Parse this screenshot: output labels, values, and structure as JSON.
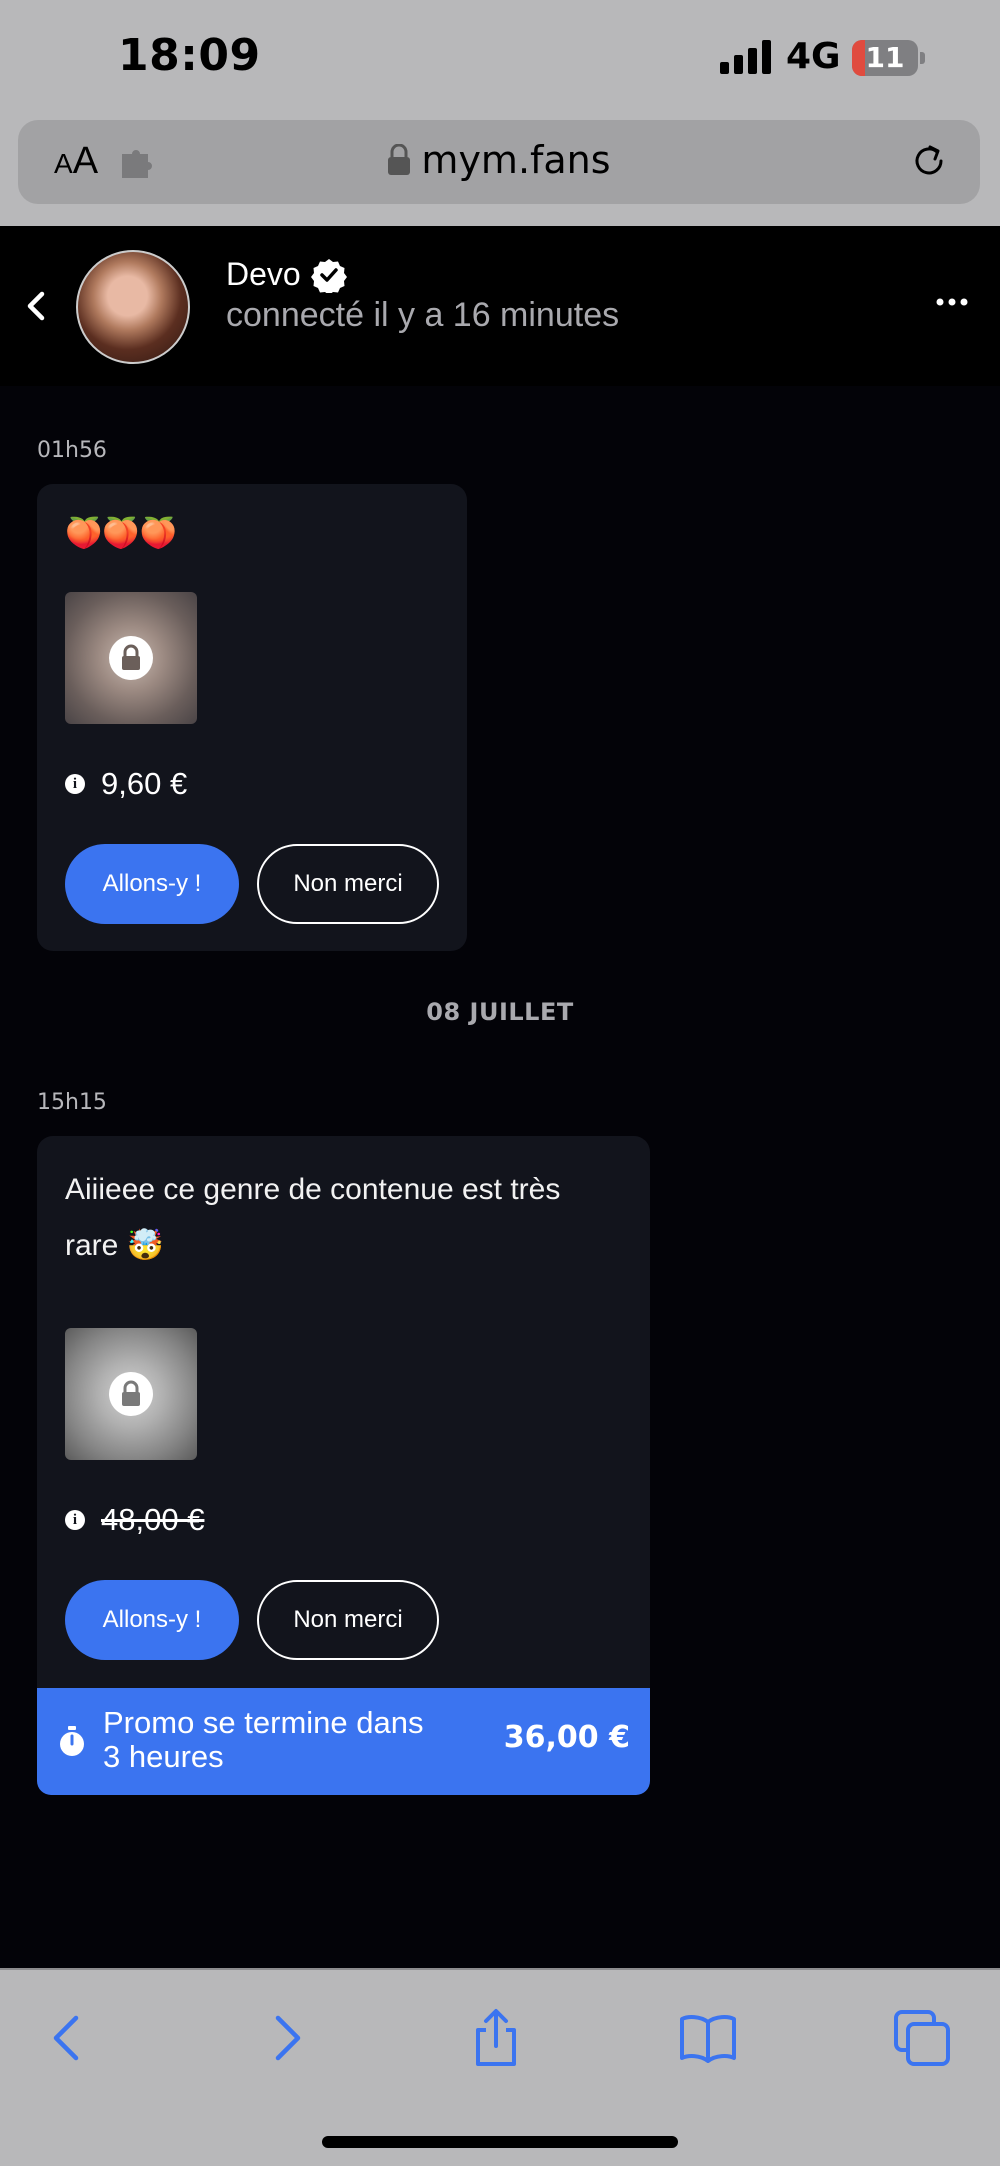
{
  "status_bar": {
    "time": "18:09",
    "network": "4G",
    "battery_level": "11",
    "battery_fraction": 0.11
  },
  "browser": {
    "text_size_small": "A",
    "text_size_big": "A",
    "url": "mym.fans"
  },
  "header": {
    "name": "Devo",
    "status": "connecté il y a 16 minutes"
  },
  "messages": [
    {
      "time": "01h56",
      "text": "🍑🍑🍑",
      "price": "9,60 €",
      "accept_label": "Allons-y !",
      "decline_label": "Non merci"
    },
    {
      "time": "15h15",
      "text_line1": "Aiiieee ce genre de contenue est très",
      "text_line2": "rare 🤯",
      "price": "48,00 €",
      "accept_label": "Allons-y !",
      "decline_label": "Non merci",
      "promo_text": "Promo se termine dans 3 heures",
      "promo_price": "36,00 €"
    }
  ],
  "date_separator": "08 JUILLET",
  "colors": {
    "accent": "#3b74f0",
    "card": "#12141c",
    "background": "#030308"
  }
}
